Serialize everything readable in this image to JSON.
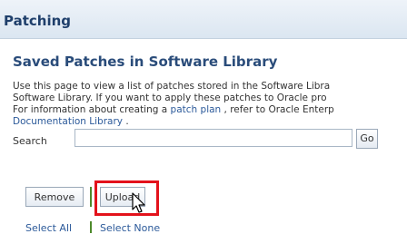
{
  "header": {
    "title": "Patching"
  },
  "section": {
    "title": "Saved Patches in Software Library"
  },
  "description": {
    "line1": "Use this page to view a list of patches stored in the Software Libra",
    "line2": "Software Library. If you want to apply these patches to Oracle pro",
    "line3_prefix": "For information about creating a ",
    "line3_link": "patch plan",
    "line3_suffix": " , refer to Oracle Enterp",
    "line4_link": "Documentation Library",
    "line4_suffix": " ."
  },
  "search": {
    "label": "Search",
    "value": "",
    "go_label": "Go"
  },
  "actions": {
    "remove_label": "Remove",
    "upload_label": "Upload"
  },
  "selection": {
    "select_all": "Select All",
    "select_none": "Select None"
  },
  "colors": {
    "accent": "#2a4c7a",
    "link": "#2c5a9a",
    "highlight": "#e3121b",
    "separator": "#4e8a2c"
  }
}
